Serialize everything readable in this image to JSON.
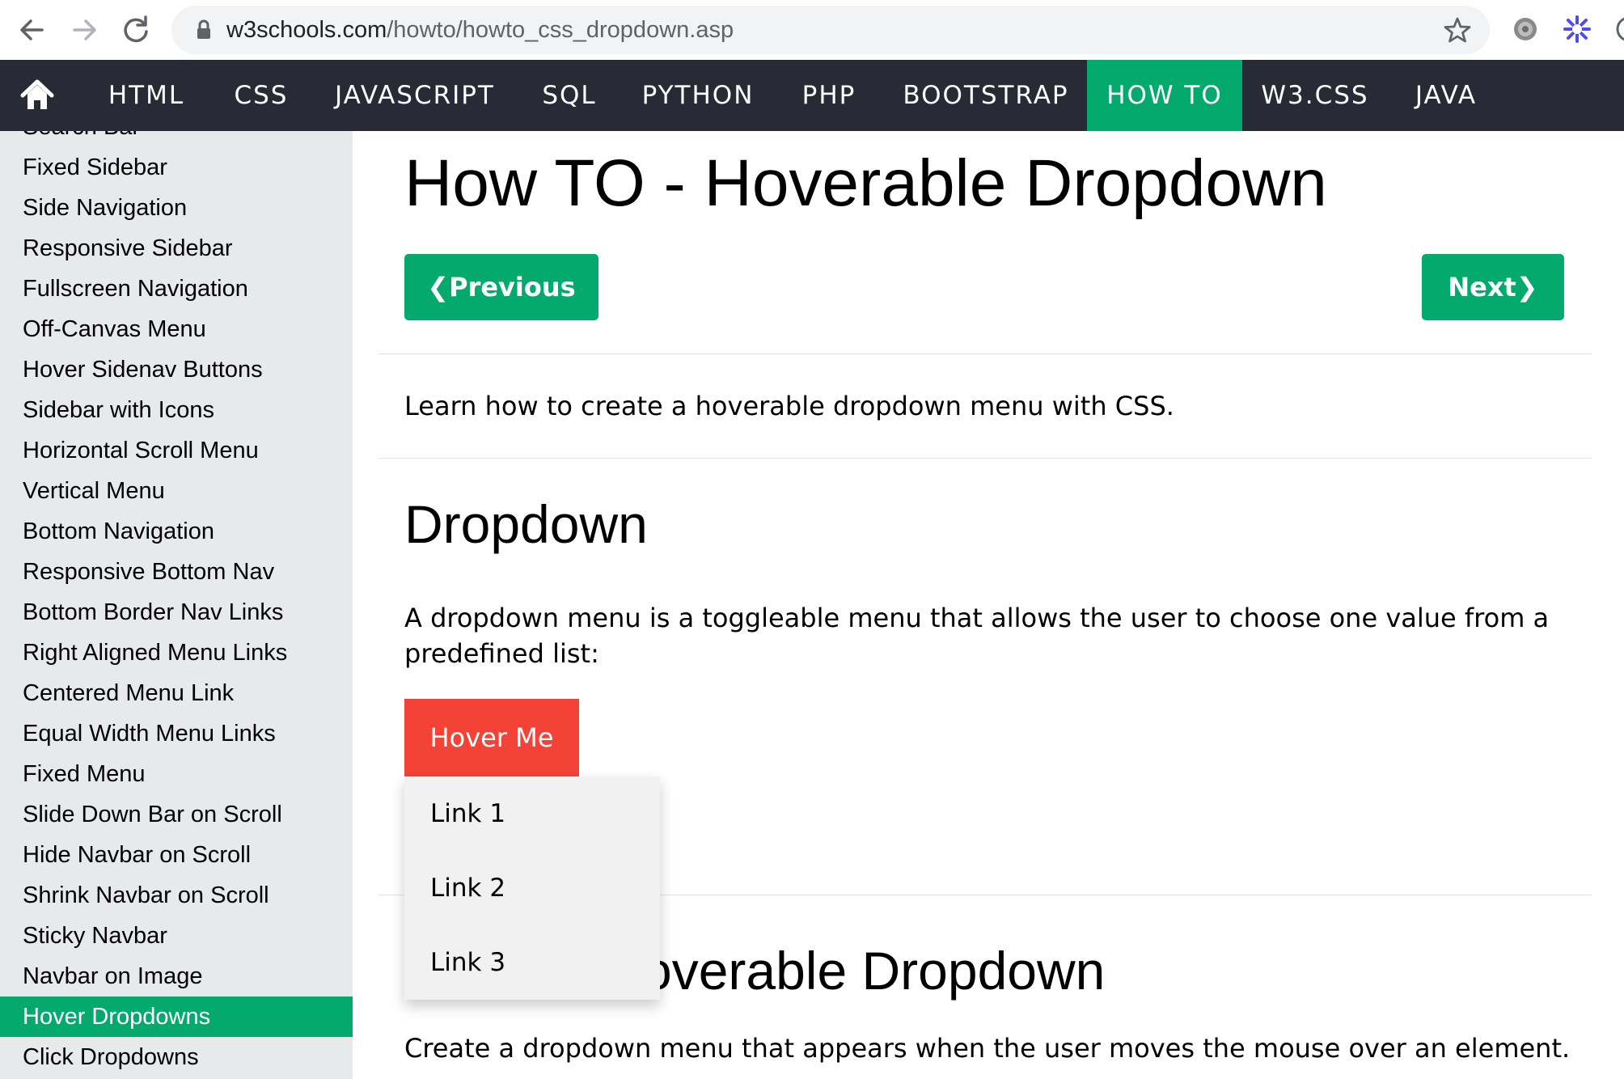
{
  "browser": {
    "url_host": "w3schools.com",
    "url_path": "/howto/howto_css_dropdown.asp",
    "icons": [
      "back-arrow-icon",
      "forward-arrow-icon",
      "reload-icon",
      "lock-icon",
      "star-icon",
      "extension-gear-icon",
      "extension-flower-icon"
    ]
  },
  "topnav": {
    "items": [
      "HTML",
      "CSS",
      "JAVASCRIPT",
      "SQL",
      "PYTHON",
      "PHP",
      "BOOTSTRAP",
      "HOW TO",
      "W3.CSS",
      "JAVA"
    ],
    "active": "HOW TO",
    "accent": "#04aa6d",
    "background": "#282a35"
  },
  "sidebar": {
    "partial_item": "Search Bar",
    "items": [
      "Fixed Sidebar",
      "Side Navigation",
      "Responsive Sidebar",
      "Fullscreen Navigation",
      "Off-Canvas Menu",
      "Hover Sidenav Buttons",
      "Sidebar with Icons",
      "Horizontal Scroll Menu",
      "Vertical Menu",
      "Bottom Navigation",
      "Responsive Bottom Nav",
      "Bottom Border Nav Links",
      "Right Aligned Menu Links",
      "Centered Menu Link",
      "Equal Width Menu Links",
      "Fixed Menu",
      "Slide Down Bar on Scroll",
      "Hide Navbar on Scroll",
      "Shrink Navbar on Scroll",
      "Sticky Navbar",
      "Navbar on Image",
      "Hover Dropdowns",
      "Click Dropdowns"
    ],
    "active": "Hover Dropdowns"
  },
  "main": {
    "title": "How TO - Hoverable Dropdown",
    "prev_label": "Previous",
    "next_label": "Next",
    "intro": "Learn how to create a hoverable dropdown menu with CSS.",
    "section1_heading": "Dropdown",
    "section1_text": "A dropdown menu is a toggleable menu that allows the user to choose one value from a predefined list:",
    "demo_button": "Hover Me",
    "dropdown_links": [
      "Link 1",
      "Link 2",
      "Link 3"
    ],
    "section2_heading_visible": "overable Dropdown",
    "section2_text": "Create a dropdown menu that appears when the user moves the mouse over an element.",
    "demo_button_color": "#f44336"
  }
}
